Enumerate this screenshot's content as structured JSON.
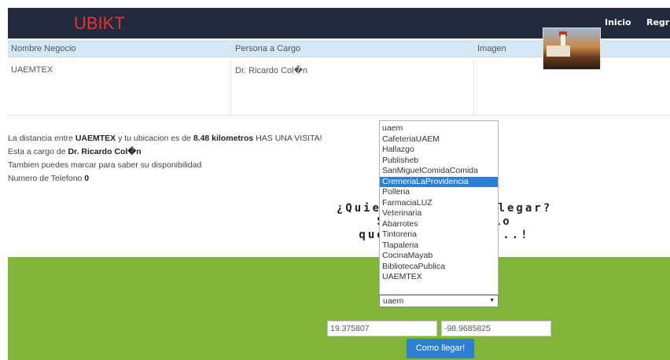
{
  "navbar": {
    "brand": "UBIKT",
    "links": [
      "Inicio",
      "Regr"
    ]
  },
  "table": {
    "headers": [
      "Nombre Negocio",
      "Persona a Cargo",
      "Imagen"
    ],
    "rows": [
      {
        "negocio": "UAEMTEX",
        "persona": "Dr. Ricardo Col�n"
      }
    ]
  },
  "info": {
    "distance_prefix": "La distancia entre",
    "business": "UAEMTEX",
    "distance_mid": "y tu ubicacion es de",
    "distance_value": "8.48 kilometros",
    "distance_suffix": "HAS UNA VISITA!",
    "manager_prefix": "Esta a cargo de",
    "manager": "Dr. Ricardo Col�n",
    "call_text": "Tambien puedes marcar para saber su disponibilidad",
    "phone_label": "Numero de Telefono",
    "phone_value": "0"
  },
  "question": {
    "line1": "¿Quiere          llegar?",
    "line2": "Sele        cio",
    "line3": "que s        lo...!"
  },
  "dropdown": {
    "options": [
      "uaem",
      "CafeteriaUAEM",
      "Hallazgo",
      "Publisheb",
      "SanMiguelComidaComida",
      "CremeriaLaProvidencia",
      "Polleria",
      "FarmaciaLUZ",
      "Veterinaria",
      "Abarrotes",
      "Tintoreria",
      "Tlapaleria",
      "CocinaMayab",
      "BibliotecaPublica",
      "UAEMTEX"
    ],
    "highlighted": "CremeriaLaProvidencia",
    "selected": "uaem"
  },
  "coords": {
    "lat": "19.375807",
    "lng": "-98.9685825"
  },
  "button": {
    "label": "Como llegar!"
  },
  "colors": {
    "navbar": "#222b3d",
    "brand": "#e8312f",
    "header": "#d4e7f4",
    "green": "#82b439",
    "accent": "#2d7fd2"
  }
}
